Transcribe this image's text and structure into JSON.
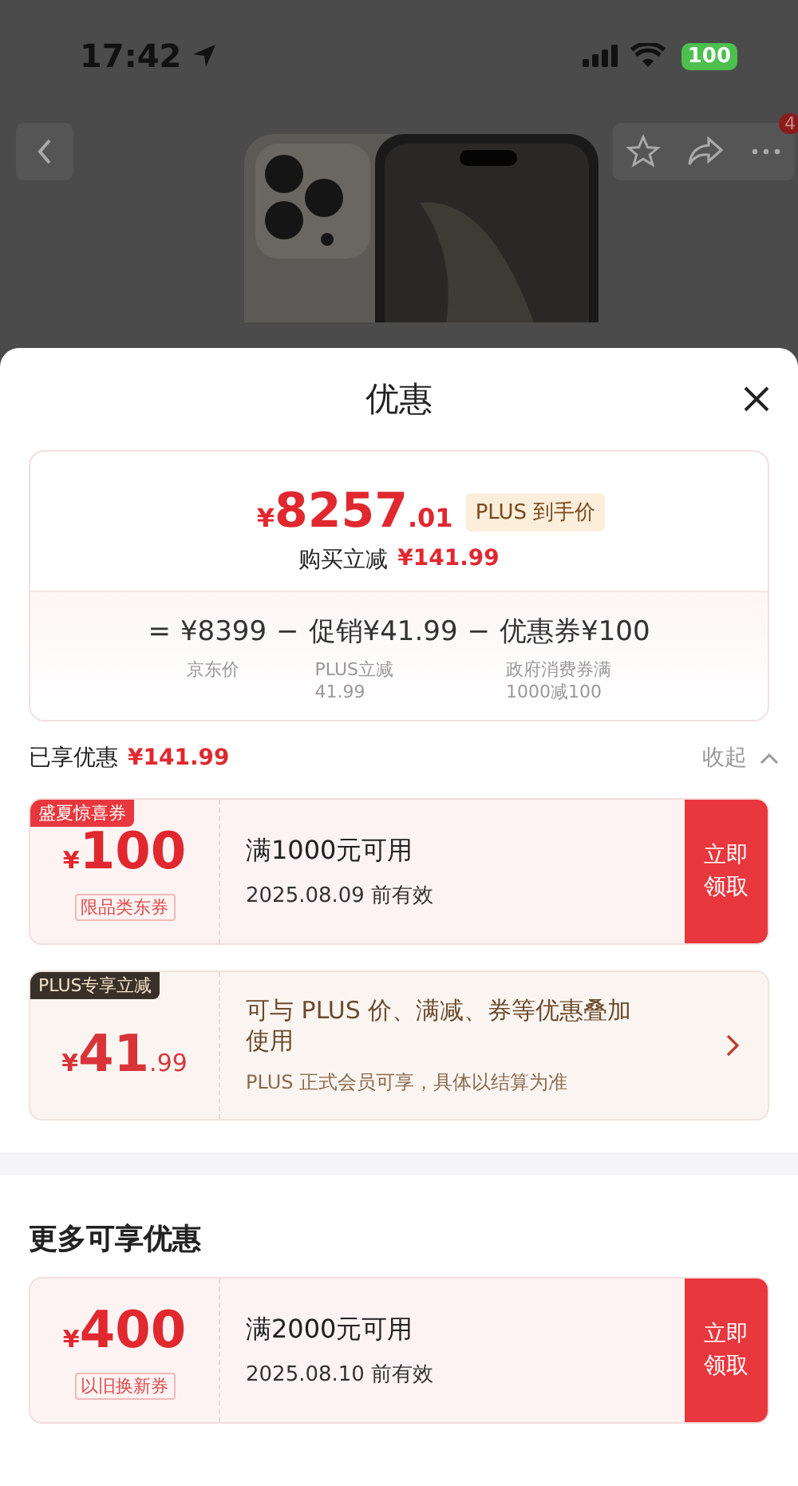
{
  "status_bar": {
    "time": "17:42",
    "battery": "100"
  },
  "nav": {
    "badge": "4"
  },
  "sheet": {
    "title": "优惠"
  },
  "summary": {
    "currency": "¥",
    "integer": "8257",
    "decimal": ".01",
    "tag": "PLUS 到手价",
    "savings_label": "购买立减",
    "savings": "¥141.99",
    "breakdown": [
      {
        "op": "=",
        "amount": "¥8399",
        "note": [
          "京东价"
        ]
      },
      {
        "op": "−",
        "amount": "促销¥41.99",
        "note": [
          "PLUS立减",
          "41.99"
        ]
      },
      {
        "op": "−",
        "amount": "优惠券¥100",
        "note": [
          "政府消费券满",
          "1000减100"
        ]
      }
    ]
  },
  "applied": {
    "label": "已享优惠",
    "amount": "¥141.99",
    "toggle": "收起",
    "expanded": true,
    "coupons": [
      {
        "kind": "coupon",
        "corner": "盛夏惊喜券",
        "currency": "¥",
        "amount": "100",
        "scope": "限品类东券",
        "title": "满1000元可用",
        "subtitle": "2025.08.09 前有效",
        "action": "立即领取"
      },
      {
        "kind": "plus",
        "corner": "PLUS专享立减",
        "currency": "¥",
        "amount": "41",
        "decimal": ".99",
        "title": "可与 PLUS 价、满减、券等优惠叠加使用",
        "subtitle": "PLUS 正式会员可享，具体以结算为准"
      }
    ]
  },
  "more": {
    "title": "更多可享优惠",
    "coupons": [
      {
        "kind": "coupon",
        "currency": "¥",
        "amount": "400",
        "scope": "以旧换新券",
        "title": "满2000元可用",
        "subtitle": "2025.08.10 前有效",
        "action": "立即领取"
      }
    ]
  }
}
